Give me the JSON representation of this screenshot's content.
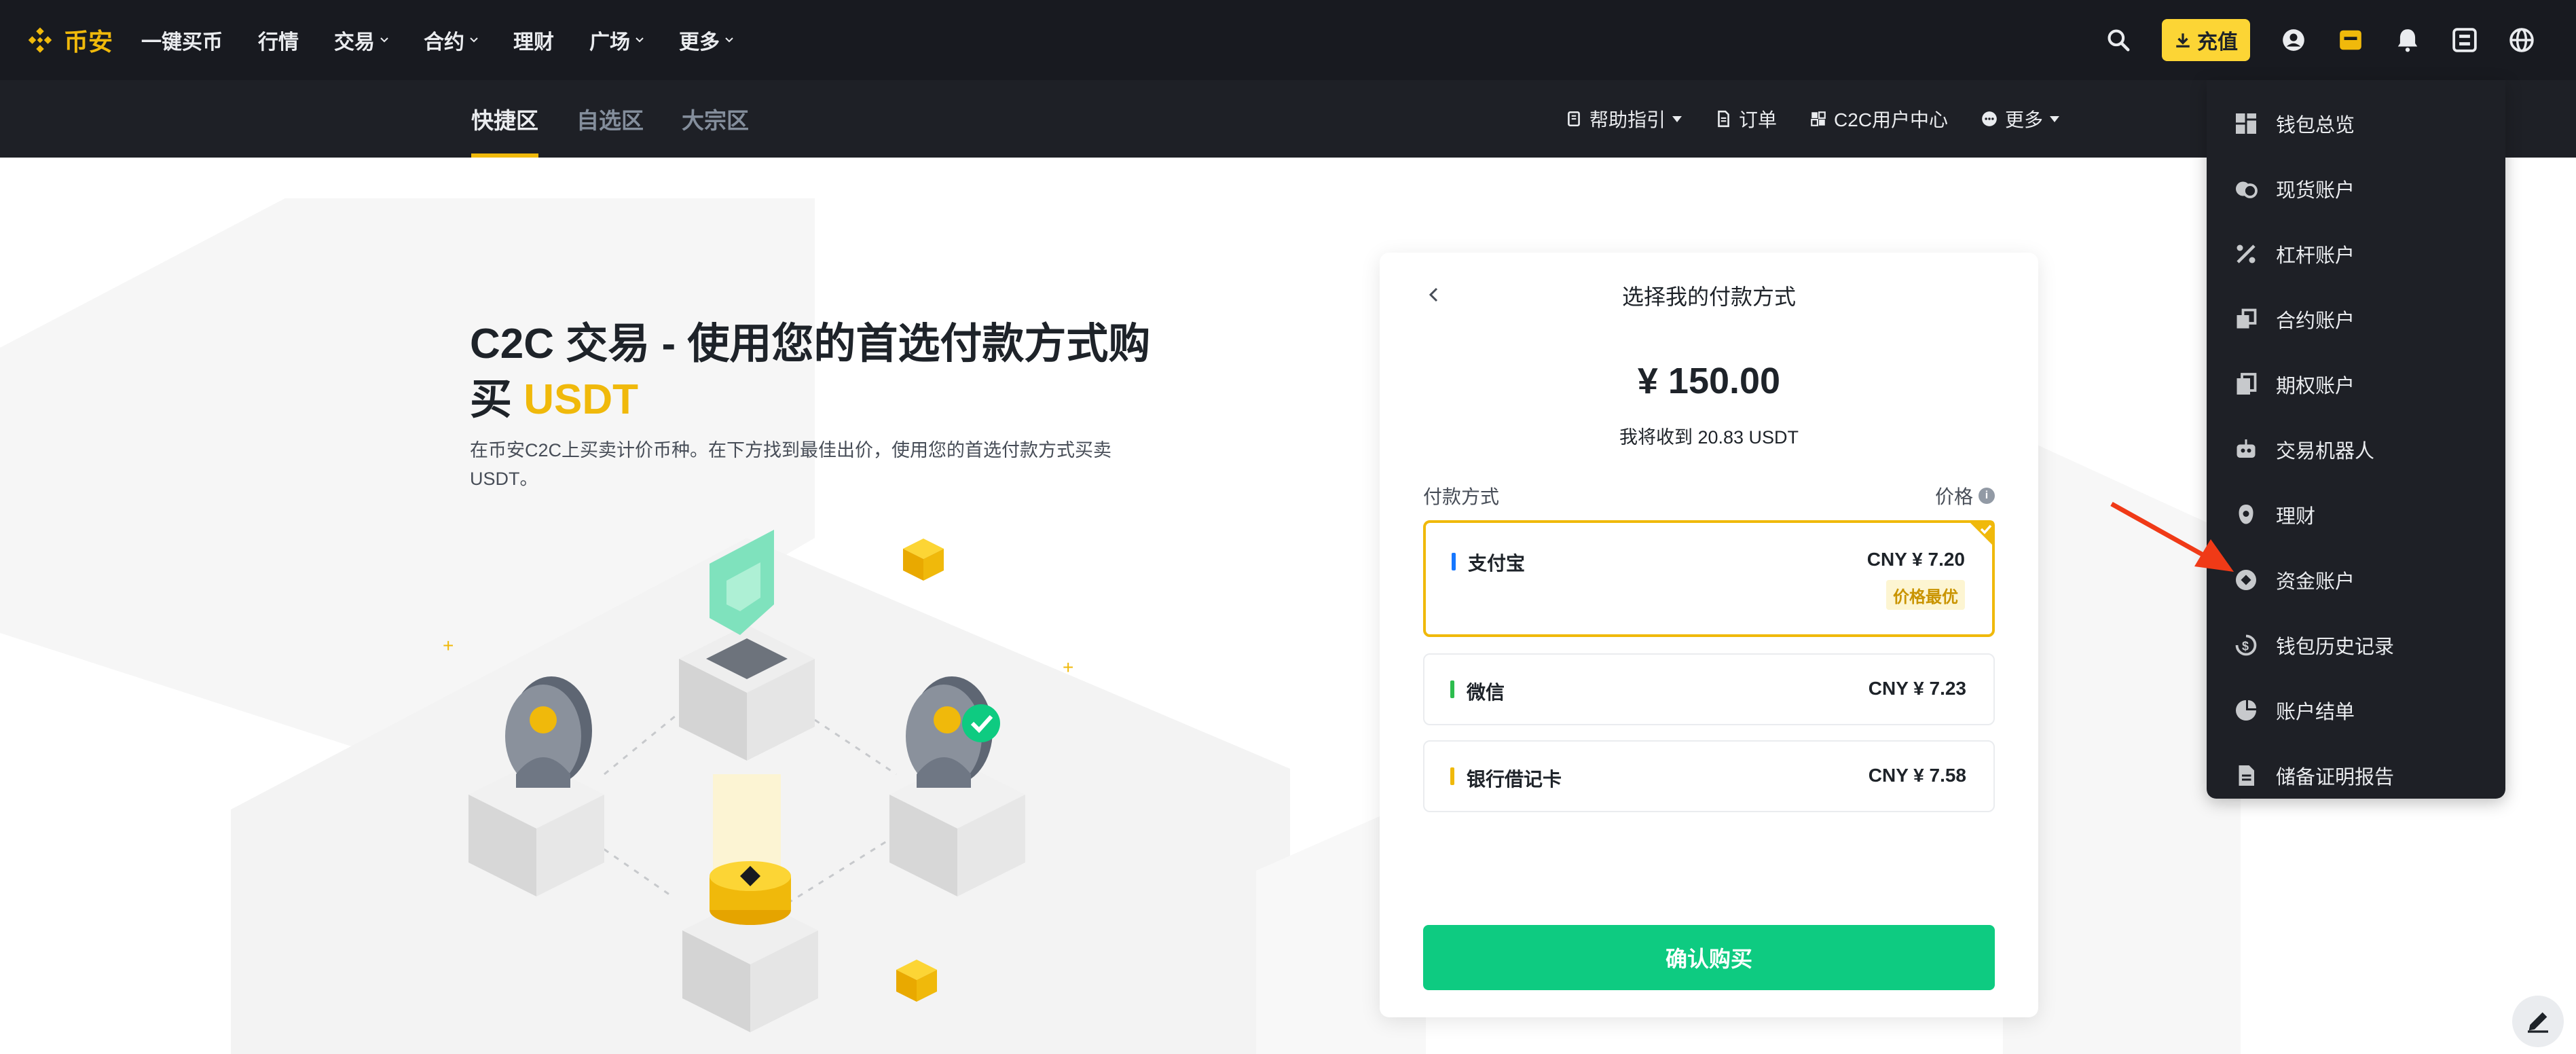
{
  "topnav": {
    "logo_text": "币安",
    "items": [
      {
        "label": "一键买币",
        "has_caret": false
      },
      {
        "label": "行情",
        "has_caret": false
      },
      {
        "label": "交易",
        "has_caret": true
      },
      {
        "label": "合约",
        "has_caret": true
      },
      {
        "label": "理财",
        "has_caret": false
      },
      {
        "label": "广场",
        "has_caret": true
      },
      {
        "label": "更多",
        "has_caret": true
      }
    ],
    "deposit_label": "充值",
    "right_icons": [
      "search-icon",
      "account-icon",
      "wallet-icon",
      "bell-icon",
      "download-icon",
      "globe-icon"
    ]
  },
  "subnav": {
    "tabs": [
      {
        "label": "快捷区",
        "active": true
      },
      {
        "label": "自选区",
        "active": false
      },
      {
        "label": "大宗区",
        "active": false
      }
    ],
    "right": {
      "help": "帮助指引",
      "orders": "订单",
      "user_center": "C2C用户中心",
      "more": "更多"
    }
  },
  "hero": {
    "title_main": "C2C 交易 - 使用您的首选付款方式购买 ",
    "title_highlight": "USDT",
    "subtitle": "在币安C2C上买卖计价币种。在下方找到最佳出价，使用您的首选付款方式买卖USDT。"
  },
  "card": {
    "title": "选择我的付款方式",
    "amount": "¥ 150.00",
    "receive": "我将收到 20.83 USDT",
    "payment_label": "付款方式",
    "price_label": "价格",
    "options": [
      {
        "name": "支付宝",
        "price": "CNY ¥ 7.20",
        "bar_color": "#1677ff",
        "selected": true,
        "badge": "价格最优"
      },
      {
        "name": "微信",
        "price": "CNY ¥ 7.23",
        "bar_color": "#2dbd4e",
        "selected": false
      },
      {
        "name": "银行借记卡",
        "price": "CNY ¥ 7.58",
        "bar_color": "#f0b90b",
        "selected": false
      }
    ],
    "confirm_label": "确认购买"
  },
  "wallet_menu": {
    "items": [
      {
        "label": "钱包总览",
        "icon": "dashboard-icon"
      },
      {
        "label": "现货账户",
        "icon": "spot-icon"
      },
      {
        "label": "杠杆账户",
        "icon": "margin-icon"
      },
      {
        "label": "合约账户",
        "icon": "futures-icon"
      },
      {
        "label": "期权账户",
        "icon": "options-icon"
      },
      {
        "label": "交易机器人",
        "icon": "robot-icon"
      },
      {
        "label": "理财",
        "icon": "earn-icon"
      },
      {
        "label": "资金账户",
        "icon": "funding-icon"
      },
      {
        "label": "钱包历史记录",
        "icon": "history-icon"
      },
      {
        "label": "账户结单",
        "icon": "statement-icon"
      },
      {
        "label": "储备证明报告",
        "icon": "report-icon"
      }
    ]
  },
  "colors": {
    "brand": "#f0b90b",
    "topnav_bg": "#181a20",
    "subnav_bg": "#1e2026",
    "confirm": "#0ecb81",
    "annotation_arrow": "#f03a17"
  }
}
